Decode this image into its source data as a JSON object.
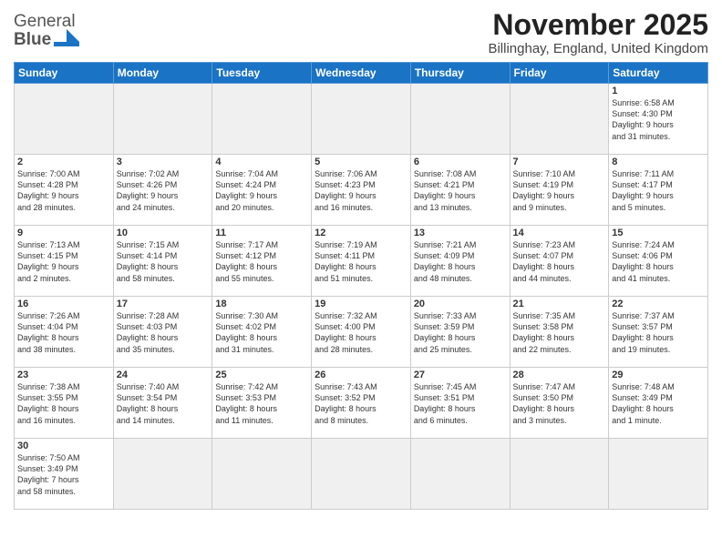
{
  "header": {
    "logo_general": "General",
    "logo_blue": "Blue",
    "title": "November 2025",
    "subtitle": "Billinghay, England, United Kingdom"
  },
  "weekdays": [
    "Sunday",
    "Monday",
    "Tuesday",
    "Wednesday",
    "Thursday",
    "Friday",
    "Saturday"
  ],
  "weeks": [
    [
      {
        "day": "",
        "info": ""
      },
      {
        "day": "",
        "info": ""
      },
      {
        "day": "",
        "info": ""
      },
      {
        "day": "",
        "info": ""
      },
      {
        "day": "",
        "info": ""
      },
      {
        "day": "",
        "info": ""
      },
      {
        "day": "1",
        "info": "Sunrise: 6:58 AM\nSunset: 4:30 PM\nDaylight: 9 hours\nand 31 minutes."
      }
    ],
    [
      {
        "day": "2",
        "info": "Sunrise: 7:00 AM\nSunset: 4:28 PM\nDaylight: 9 hours\nand 28 minutes."
      },
      {
        "day": "3",
        "info": "Sunrise: 7:02 AM\nSunset: 4:26 PM\nDaylight: 9 hours\nand 24 minutes."
      },
      {
        "day": "4",
        "info": "Sunrise: 7:04 AM\nSunset: 4:24 PM\nDaylight: 9 hours\nand 20 minutes."
      },
      {
        "day": "5",
        "info": "Sunrise: 7:06 AM\nSunset: 4:23 PM\nDaylight: 9 hours\nand 16 minutes."
      },
      {
        "day": "6",
        "info": "Sunrise: 7:08 AM\nSunset: 4:21 PM\nDaylight: 9 hours\nand 13 minutes."
      },
      {
        "day": "7",
        "info": "Sunrise: 7:10 AM\nSunset: 4:19 PM\nDaylight: 9 hours\nand 9 minutes."
      },
      {
        "day": "8",
        "info": "Sunrise: 7:11 AM\nSunset: 4:17 PM\nDaylight: 9 hours\nand 5 minutes."
      }
    ],
    [
      {
        "day": "9",
        "info": "Sunrise: 7:13 AM\nSunset: 4:15 PM\nDaylight: 9 hours\nand 2 minutes."
      },
      {
        "day": "10",
        "info": "Sunrise: 7:15 AM\nSunset: 4:14 PM\nDaylight: 8 hours\nand 58 minutes."
      },
      {
        "day": "11",
        "info": "Sunrise: 7:17 AM\nSunset: 4:12 PM\nDaylight: 8 hours\nand 55 minutes."
      },
      {
        "day": "12",
        "info": "Sunrise: 7:19 AM\nSunset: 4:11 PM\nDaylight: 8 hours\nand 51 minutes."
      },
      {
        "day": "13",
        "info": "Sunrise: 7:21 AM\nSunset: 4:09 PM\nDaylight: 8 hours\nand 48 minutes."
      },
      {
        "day": "14",
        "info": "Sunrise: 7:23 AM\nSunset: 4:07 PM\nDaylight: 8 hours\nand 44 minutes."
      },
      {
        "day": "15",
        "info": "Sunrise: 7:24 AM\nSunset: 4:06 PM\nDaylight: 8 hours\nand 41 minutes."
      }
    ],
    [
      {
        "day": "16",
        "info": "Sunrise: 7:26 AM\nSunset: 4:04 PM\nDaylight: 8 hours\nand 38 minutes."
      },
      {
        "day": "17",
        "info": "Sunrise: 7:28 AM\nSunset: 4:03 PM\nDaylight: 8 hours\nand 35 minutes."
      },
      {
        "day": "18",
        "info": "Sunrise: 7:30 AM\nSunset: 4:02 PM\nDaylight: 8 hours\nand 31 minutes."
      },
      {
        "day": "19",
        "info": "Sunrise: 7:32 AM\nSunset: 4:00 PM\nDaylight: 8 hours\nand 28 minutes."
      },
      {
        "day": "20",
        "info": "Sunrise: 7:33 AM\nSunset: 3:59 PM\nDaylight: 8 hours\nand 25 minutes."
      },
      {
        "day": "21",
        "info": "Sunrise: 7:35 AM\nSunset: 3:58 PM\nDaylight: 8 hours\nand 22 minutes."
      },
      {
        "day": "22",
        "info": "Sunrise: 7:37 AM\nSunset: 3:57 PM\nDaylight: 8 hours\nand 19 minutes."
      }
    ],
    [
      {
        "day": "23",
        "info": "Sunrise: 7:38 AM\nSunset: 3:55 PM\nDaylight: 8 hours\nand 16 minutes."
      },
      {
        "day": "24",
        "info": "Sunrise: 7:40 AM\nSunset: 3:54 PM\nDaylight: 8 hours\nand 14 minutes."
      },
      {
        "day": "25",
        "info": "Sunrise: 7:42 AM\nSunset: 3:53 PM\nDaylight: 8 hours\nand 11 minutes."
      },
      {
        "day": "26",
        "info": "Sunrise: 7:43 AM\nSunset: 3:52 PM\nDaylight: 8 hours\nand 8 minutes."
      },
      {
        "day": "27",
        "info": "Sunrise: 7:45 AM\nSunset: 3:51 PM\nDaylight: 8 hours\nand 6 minutes."
      },
      {
        "day": "28",
        "info": "Sunrise: 7:47 AM\nSunset: 3:50 PM\nDaylight: 8 hours\nand 3 minutes."
      },
      {
        "day": "29",
        "info": "Sunrise: 7:48 AM\nSunset: 3:49 PM\nDaylight: 8 hours\nand 1 minute."
      }
    ],
    [
      {
        "day": "30",
        "info": "Sunrise: 7:50 AM\nSunset: 3:49 PM\nDaylight: 7 hours\nand 58 minutes."
      },
      {
        "day": "",
        "info": ""
      },
      {
        "day": "",
        "info": ""
      },
      {
        "day": "",
        "info": ""
      },
      {
        "day": "",
        "info": ""
      },
      {
        "day": "",
        "info": ""
      },
      {
        "day": "",
        "info": ""
      }
    ]
  ]
}
